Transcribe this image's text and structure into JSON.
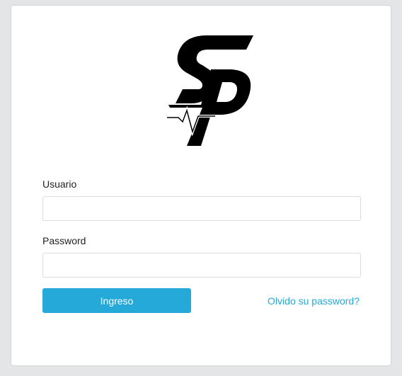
{
  "logo": {
    "icon": "sp-pulse-logo-icon",
    "color": "#000000"
  },
  "form": {
    "user_label": "Usuario",
    "user_value": "",
    "password_label": "Password",
    "password_value": "",
    "submit_label": "Ingreso",
    "forgot_label": "Olvido su password?"
  },
  "colors": {
    "accent": "#25a9d8",
    "background": "#e4e5e7",
    "card": "#ffffff"
  }
}
